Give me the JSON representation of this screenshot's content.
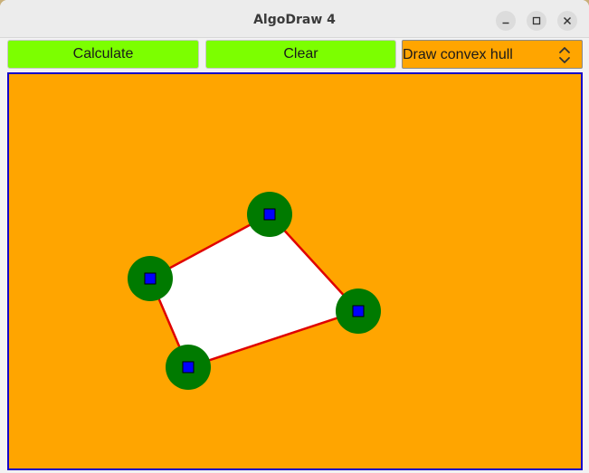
{
  "window": {
    "title": "AlgoDraw 4"
  },
  "toolbar": {
    "calculate_label": "Calculate",
    "clear_label": "Clear",
    "mode_select": {
      "selected": "Draw convex hull"
    }
  },
  "colors": {
    "canvas_background": "#ffa500",
    "canvas_border": "#1400c8",
    "button_background": "#7cff00",
    "hull_fill": "#ffffff",
    "hull_edge": "#e00000",
    "point_outer": "#007a00",
    "point_inner": "#0000ff"
  },
  "icons": {
    "minimize": "minimize-icon",
    "maximize": "maximize-icon",
    "close": "close-icon",
    "dropdown": "updown-chevron-icon"
  }
}
